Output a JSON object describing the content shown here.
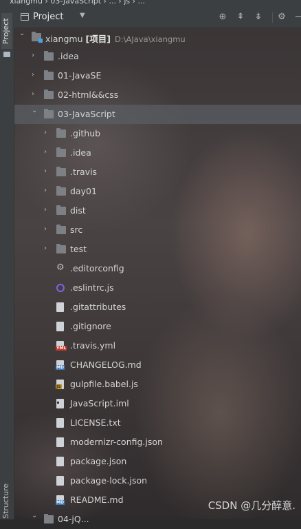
{
  "breadcrumb": "xiangmu › 03-JavaScript › ... › js › ...",
  "left_tabs": {
    "project": "Project",
    "structure": "Structure"
  },
  "header": {
    "title": "Project",
    "dropdown_icon": "chevron-down-icon"
  },
  "toolbar": [
    "locate-icon",
    "collapse-icon",
    "expand-icon",
    "gear-icon",
    "hide-icon"
  ],
  "tree": [
    {
      "label": "xiangmu",
      "suffix": "[项目]",
      "path": "D:\\AJava\\xiangmu",
      "depth": 0,
      "type": "module-folder",
      "expanded": true
    },
    {
      "label": ".idea",
      "depth": 1,
      "type": "folder",
      "expanded": false
    },
    {
      "label": "01-JavaSE",
      "depth": 1,
      "type": "folder",
      "expanded": false
    },
    {
      "label": "02-html&&css",
      "depth": 1,
      "type": "folder",
      "expanded": false
    },
    {
      "label": "03-JavaScript",
      "depth": 1,
      "type": "folder",
      "expanded": true,
      "selected": true
    },
    {
      "label": ".github",
      "depth": 2,
      "type": "folder",
      "expanded": false
    },
    {
      "label": ".idea",
      "depth": 2,
      "type": "folder",
      "expanded": false
    },
    {
      "label": ".travis",
      "depth": 2,
      "type": "folder",
      "expanded": false
    },
    {
      "label": "day01",
      "depth": 2,
      "type": "folder",
      "expanded": false
    },
    {
      "label": "dist",
      "depth": 2,
      "type": "folder",
      "expanded": false
    },
    {
      "label": "src",
      "depth": 2,
      "type": "folder",
      "expanded": false
    },
    {
      "label": "test",
      "depth": 2,
      "type": "folder",
      "expanded": false
    },
    {
      "label": ".editorconfig",
      "depth": 2,
      "type": "config"
    },
    {
      "label": ".eslintrc.js",
      "depth": 2,
      "type": "eslint"
    },
    {
      "label": ".gitattributes",
      "depth": 2,
      "type": "text"
    },
    {
      "label": ".gitignore",
      "depth": 2,
      "type": "text"
    },
    {
      "label": ".travis.yml",
      "depth": 2,
      "type": "yml"
    },
    {
      "label": "CHANGELOG.md",
      "depth": 2,
      "type": "md"
    },
    {
      "label": "gulpfile.babel.js",
      "depth": 2,
      "type": "js"
    },
    {
      "label": "JavaScript.iml",
      "depth": 2,
      "type": "iml"
    },
    {
      "label": "LICENSE.txt",
      "depth": 2,
      "type": "text"
    },
    {
      "label": "modernizr-config.json",
      "depth": 2,
      "type": "text"
    },
    {
      "label": "package.json",
      "depth": 2,
      "type": "text"
    },
    {
      "label": "package-lock.json",
      "depth": 2,
      "type": "text"
    },
    {
      "label": "README.md",
      "depth": 2,
      "type": "md"
    },
    {
      "label": "04-jQ...",
      "depth": 1,
      "type": "folder",
      "expanded": true
    }
  ],
  "watermark": "CSDN @几分醉意."
}
